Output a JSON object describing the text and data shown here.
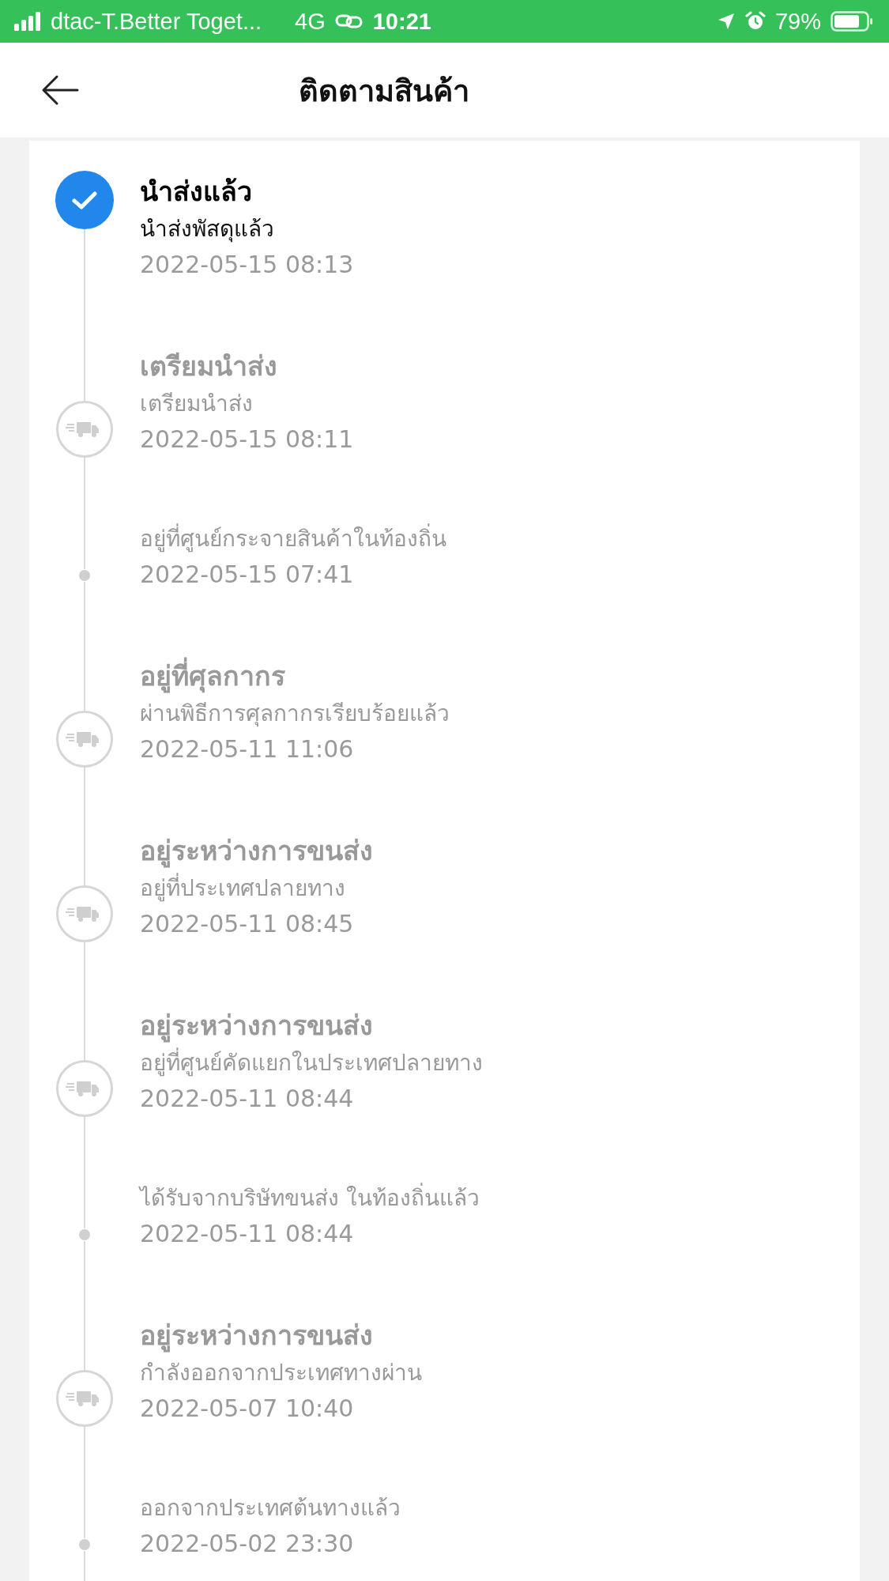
{
  "status_bar": {
    "carrier": "dtac-T.Better Toget...",
    "network": "4G",
    "time": "10:21",
    "battery": "79%"
  },
  "header": {
    "title": "ติดตามสินค้า"
  },
  "events": [
    {
      "kind": "delivered",
      "title": "นำส่งแล้ว",
      "description": "นำส่งพัสดุแล้ว",
      "time": "2022-05-15 08:13"
    },
    {
      "kind": "milestone",
      "title": "เตรียมนำส่ง",
      "description": "เตรียมนำส่ง",
      "time": "2022-05-15 08:11"
    },
    {
      "kind": "update",
      "description": "อยู่ที่ศูนย์กระจายสินค้าในท้องถิ่น",
      "time": "2022-05-15 07:41"
    },
    {
      "kind": "milestone",
      "title": "อยู่ที่ศุลกากร",
      "description": "ผ่านพิธีการศุลกากรเรียบร้อยแล้ว",
      "time": "2022-05-11 11:06"
    },
    {
      "kind": "milestone",
      "title": "อยู่ระหว่างการขนส่ง",
      "description": "อยู่ที่ประเทศปลายทาง",
      "time": "2022-05-11 08:45"
    },
    {
      "kind": "milestone",
      "title": "อยู่ระหว่างการขนส่ง",
      "description": "อยู่ที่ศูนย์คัดแยกในประเทศปลายทาง",
      "time": "2022-05-11 08:44"
    },
    {
      "kind": "update",
      "description": "ได้รับจากบริษัทขนส่ง ในท้องถิ่นแล้ว",
      "time": "2022-05-11 08:44"
    },
    {
      "kind": "milestone",
      "title": "อยู่ระหว่างการขนส่ง",
      "description": "กำลังออกจากประเทศทางผ่าน",
      "time": "2022-05-07 10:40"
    },
    {
      "kind": "update",
      "description": "ออกจากประเทศต้นทางแล้ว",
      "time": "2022-05-02 23:30"
    }
  ]
}
